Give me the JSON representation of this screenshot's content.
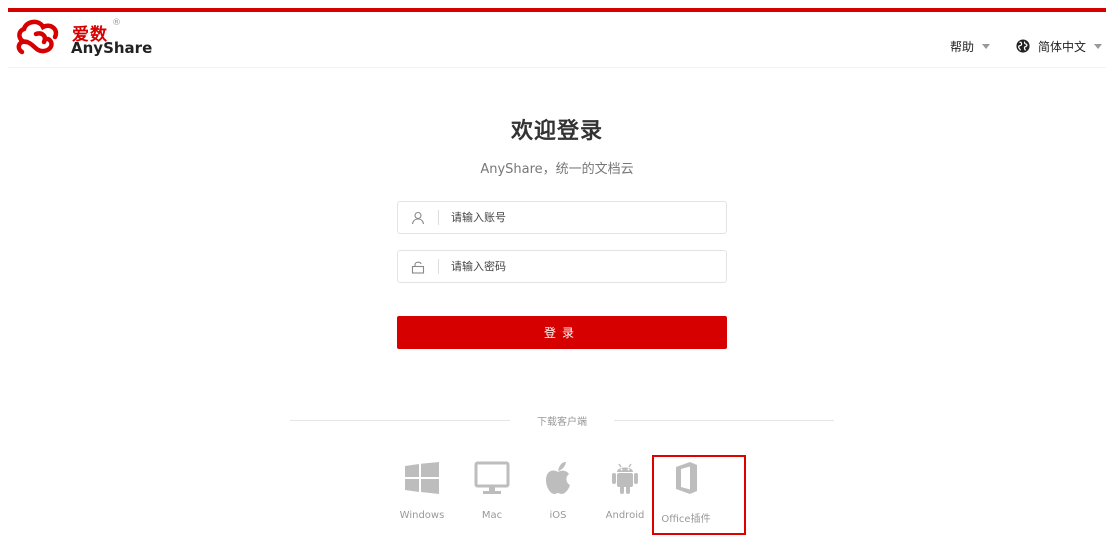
{
  "brand": {
    "name_cn": "爱数",
    "name_en": "AnyShare",
    "registered_mark": "®",
    "accent_color": "#d60000"
  },
  "header": {
    "help_label": "帮助",
    "language_label": "简体中文"
  },
  "login": {
    "title": "欢迎登录",
    "subtitle": "AnyShare，统一的文档云",
    "account_placeholder": "请输入账号",
    "password_placeholder": "请输入密码",
    "submit_label": "登录"
  },
  "downloads": {
    "heading": "下载客户端",
    "clients": [
      {
        "label": "Windows",
        "icon": "windows-icon"
      },
      {
        "label": "Mac",
        "icon": "monitor-icon"
      },
      {
        "label": "iOS",
        "icon": "apple-icon"
      },
      {
        "label": "Android",
        "icon": "android-icon"
      },
      {
        "label": "Office插件",
        "icon": "office-icon"
      }
    ]
  }
}
